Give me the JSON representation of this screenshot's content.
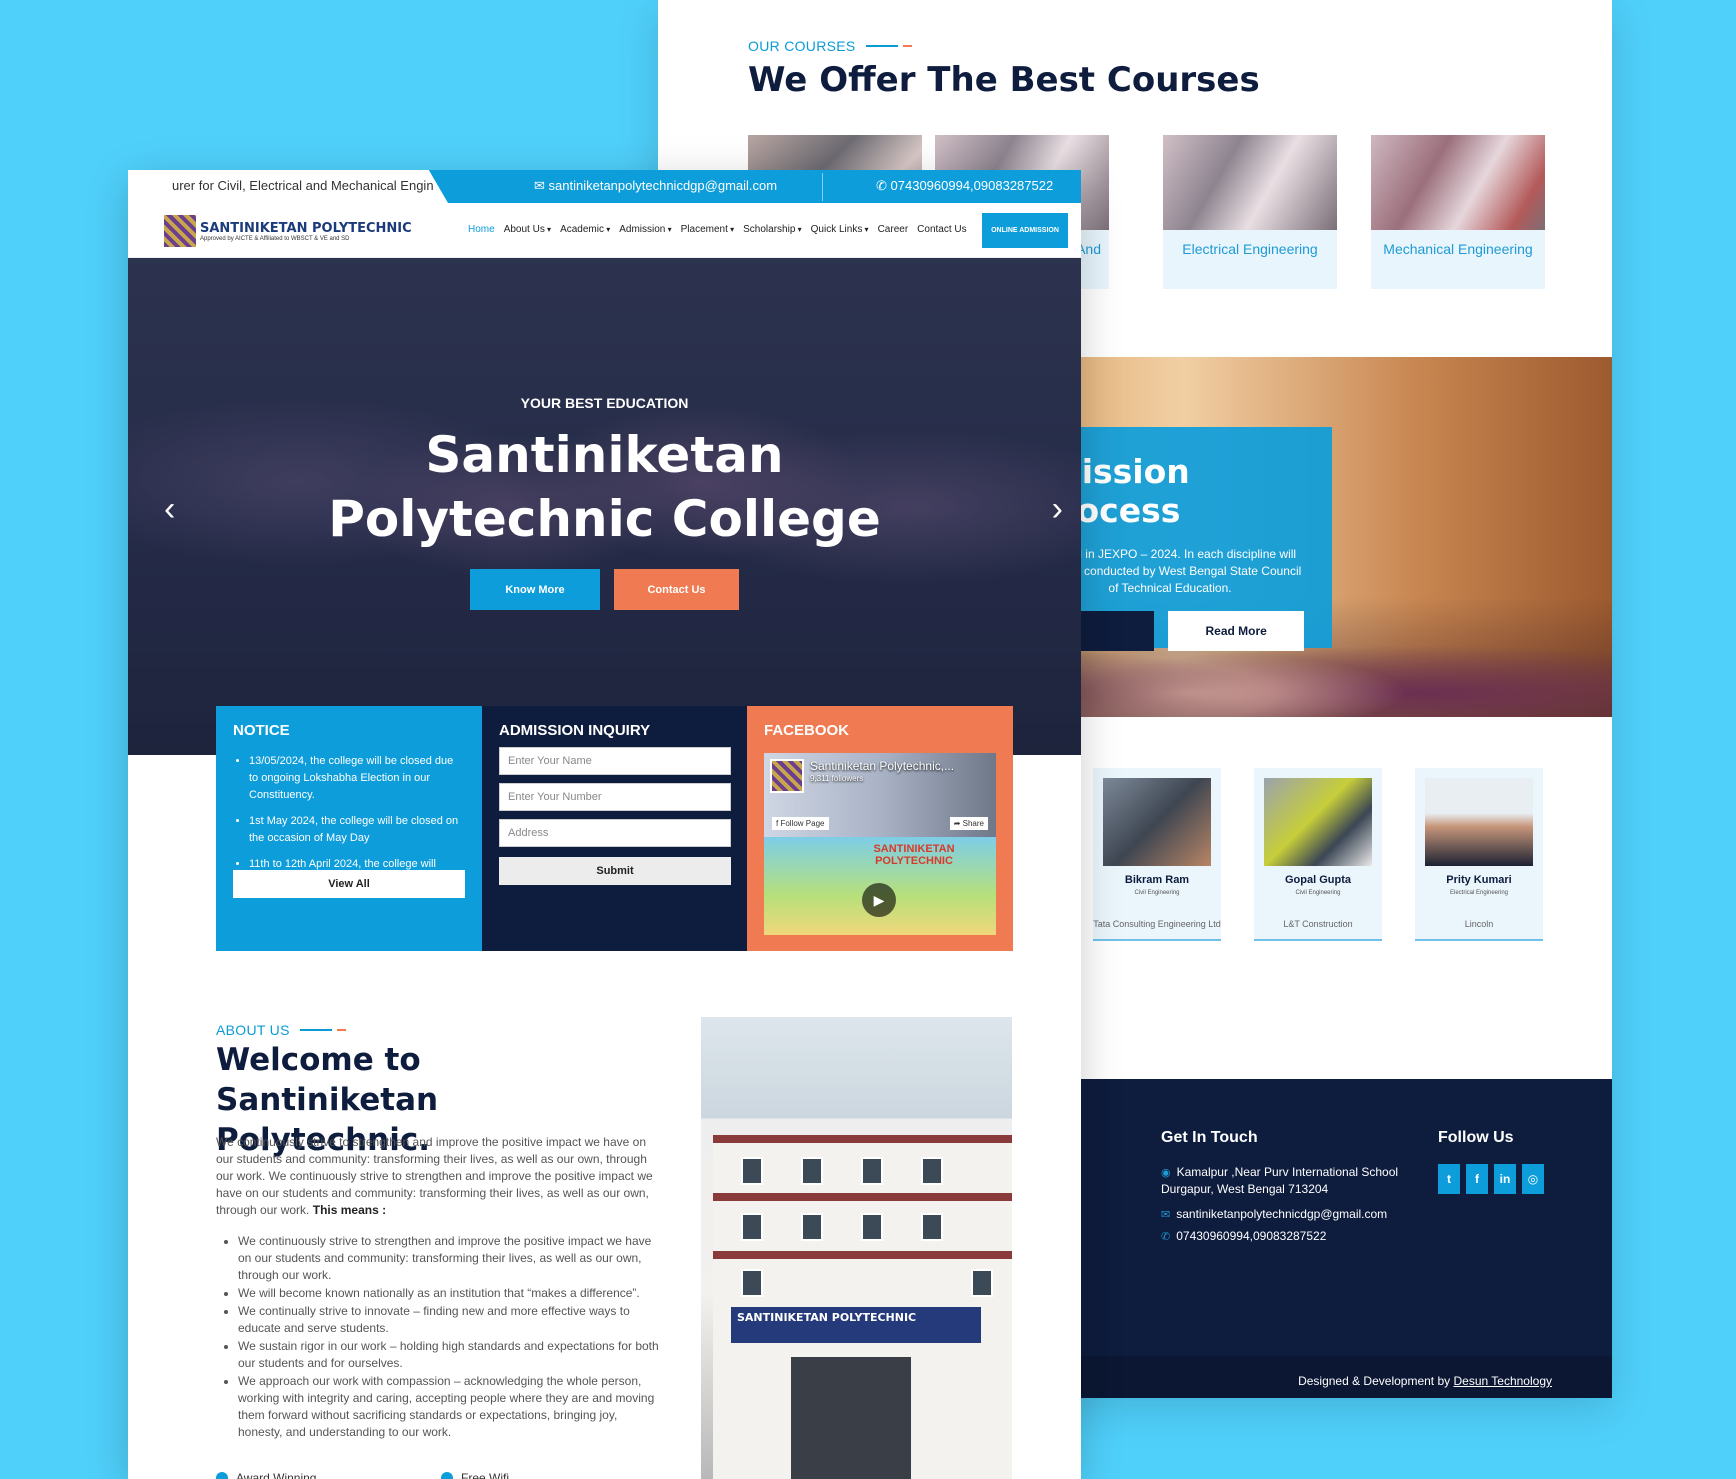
{
  "back": {
    "courses_eyebrow": "OUR COURSES",
    "courses_title": "We Offer The Best Courses",
    "courses": [
      {
        "label": "And"
      },
      {
        "label": "Electrical Engineering"
      },
      {
        "label": "Mechanical Engineering"
      }
    ],
    "admission": {
      "title": "lmission Process",
      "desc": "ualified in JEXPO – 2024. In each discipline will be eling conducted by West Bengal State Council of Technical Education.",
      "read_more": "Read More"
    },
    "alumni": [
      {
        "name": "Bikram Ram",
        "branch": "Civil Engineering",
        "company": "Tata Consulting Engineering Ltd"
      },
      {
        "name": "Gopal Gupta",
        "branch": "Civil Engineering",
        "company": "L&T Construction"
      },
      {
        "name": "Prity Kumari",
        "branch": "Electrical Engineering",
        "company": "Lincoln"
      }
    ],
    "footer": {
      "get_in_touch": "Get In Touch",
      "follow_us": "Follow Us",
      "address": "Kamalpur ,Near Purv International School Durgapur, West Bengal 713204",
      "email": "santiniketanpolytechnicdgp@gmail.com",
      "phone": "07430960994,09083287522",
      "credit_prefix": "Designed & Development by ",
      "credit_link": "Desun Technology",
      "social": [
        "twitter-icon",
        "facebook-icon",
        "linkedin-icon",
        "instagram-icon"
      ]
    },
    "to_top": "↑"
  },
  "front": {
    "topbar": {
      "marquee": "urer for Civil, Electrical and Mechanical Engin",
      "email": "santiniketanpolytechnicdgp@gmail.com",
      "phone": "07430960994,09083287522"
    },
    "logo": {
      "name": "SANTINIKETAN POLYTECHNIC",
      "tagline": "Approved by AICTE & Affiliated to WBSCT & VE and SD"
    },
    "nav": [
      {
        "label": "Home",
        "active": true
      },
      {
        "label": "About Us",
        "dropdown": true
      },
      {
        "label": "Academic",
        "dropdown": true
      },
      {
        "label": "Admission",
        "dropdown": true
      },
      {
        "label": "Placement",
        "dropdown": true
      },
      {
        "label": "Scholarship",
        "dropdown": true
      },
      {
        "label": "Quick Links",
        "dropdown": true
      },
      {
        "label": "Career"
      },
      {
        "label": "Contact Us"
      }
    ],
    "online_admission": "ONLINE ADMISSION",
    "hero": {
      "eyebrow": "YOUR BEST EDUCATION",
      "title": "Santiniketan Polytechnic College",
      "know_more": "Know More",
      "contact_us": "Contact Us"
    },
    "notice": {
      "title": "NOTICE",
      "items": [
        "13/05/2024, the college will be closed due to ongoing Lokshabha Election in our Constituency.",
        "1st May 2024, the college will be closed on the occasion of May Day",
        "11th to 12th April 2024, the college will"
      ],
      "view_all": "View All"
    },
    "inquiry": {
      "title": "ADMISSION INQUIRY",
      "name_ph": "Enter Your Name",
      "number_ph": "Enter Your Number",
      "address_ph": "Address",
      "submit": "Submit"
    },
    "facebook": {
      "title": "FACEBOOK",
      "page_name": "Santiniketan Polytechnic,...",
      "followers": "9,311 followers",
      "follow": "Follow Page",
      "share": "Share",
      "post_title": "SANTINIKETAN POLYTECHNIC"
    },
    "about": {
      "eyebrow": "ABOUT US",
      "title": "Welcome to Santiniketan Polytechnic.",
      "text": "We continuously strive to strengthen and improve the positive impact we have on our students and community: transforming their lives, as well as our own, through our work. We continuously strive to strengthen and improve the positive impact we have on our students and community: transforming their lives, as well as our own, through our work.",
      "means": "This means :",
      "list": [
        "We continuously strive to strengthen and improve the positive impact we have on our students and community: transforming their lives, as well as our own, through our work.",
        "We will become known nationally as an institution that “makes a difference”.",
        "We continually strive to innovate – finding new and more effective ways to educate and serve students.",
        "We sustain rigor in our work – holding high standards and expectations for both our students and for ourselves.",
        "We approach our work with compassion – acknowledging the whole person, working with integrity and caring, accepting people where they are and moving them forward without sacrificing standards or expectations, bringing joy, honesty, and understanding to our work."
      ],
      "features": [
        "Award Winning",
        "Free Wifi"
      ],
      "building_sign": "SANTINIKETAN POLYTECHNIC"
    }
  }
}
